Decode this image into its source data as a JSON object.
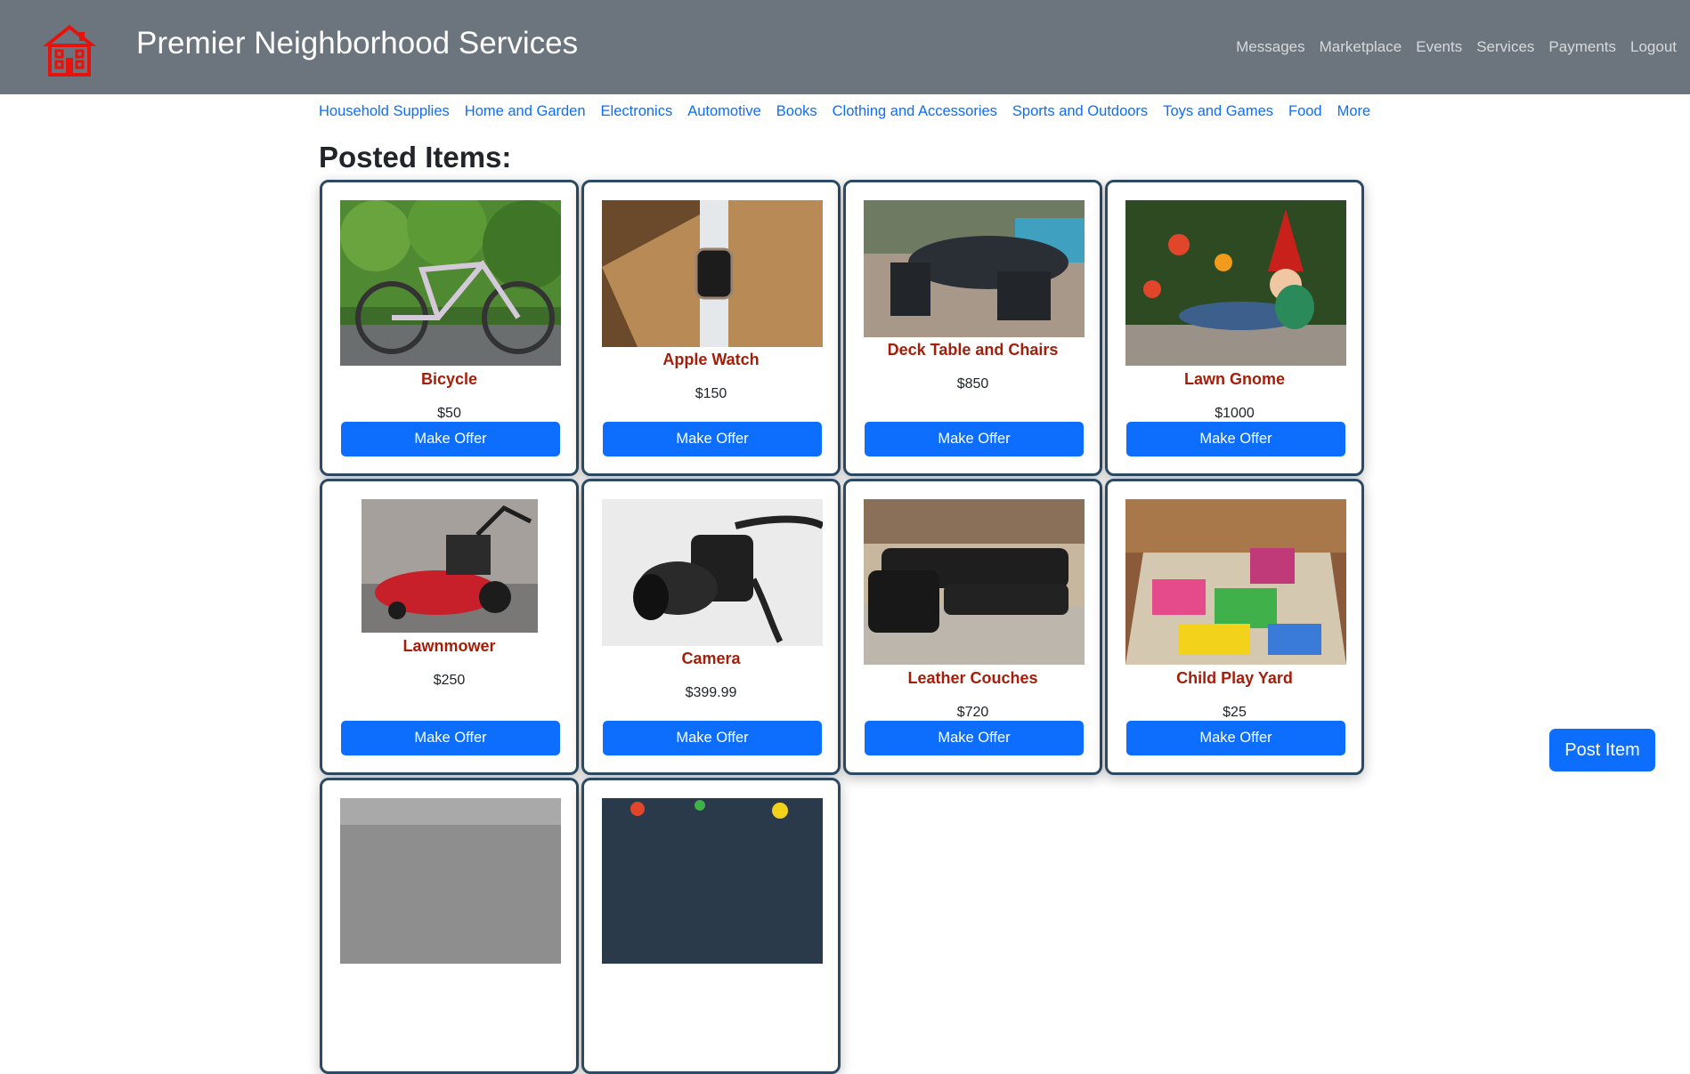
{
  "header": {
    "title": "Premier Neighborhood Services",
    "logo_icon": "house-icon",
    "logo_color": "#e8120c",
    "nav": [
      "Messages",
      "Marketplace",
      "Events",
      "Services",
      "Payments",
      "Logout"
    ]
  },
  "categories": [
    "Household Supplies",
    "Home and Garden",
    "Electronics",
    "Automotive",
    "Books",
    "Clothing and Accessories",
    "Sports and Outdoors",
    "Toys and Games",
    "Food",
    "More"
  ],
  "main": {
    "section_title": "Posted Items:",
    "offer_label": "Make Offer",
    "items": [
      {
        "name": "Bicycle",
        "price": "$50"
      },
      {
        "name": "Apple Watch",
        "price": "$150"
      },
      {
        "name": "Deck Table and Chairs",
        "price": "$850"
      },
      {
        "name": "Lawn Gnome",
        "price": "$1000"
      },
      {
        "name": "Lawnmower",
        "price": "$250"
      },
      {
        "name": "Camera",
        "price": "$399.99"
      },
      {
        "name": "Leather Couches",
        "price": "$720"
      },
      {
        "name": "Child Play Yard",
        "price": "$25"
      }
    ]
  },
  "post_item_label": "Post Item",
  "colors": {
    "header_bg": "#6c757d",
    "accent": "#0d6efd",
    "item_name": "#a31f0c",
    "card_border": "#2c4a63"
  }
}
